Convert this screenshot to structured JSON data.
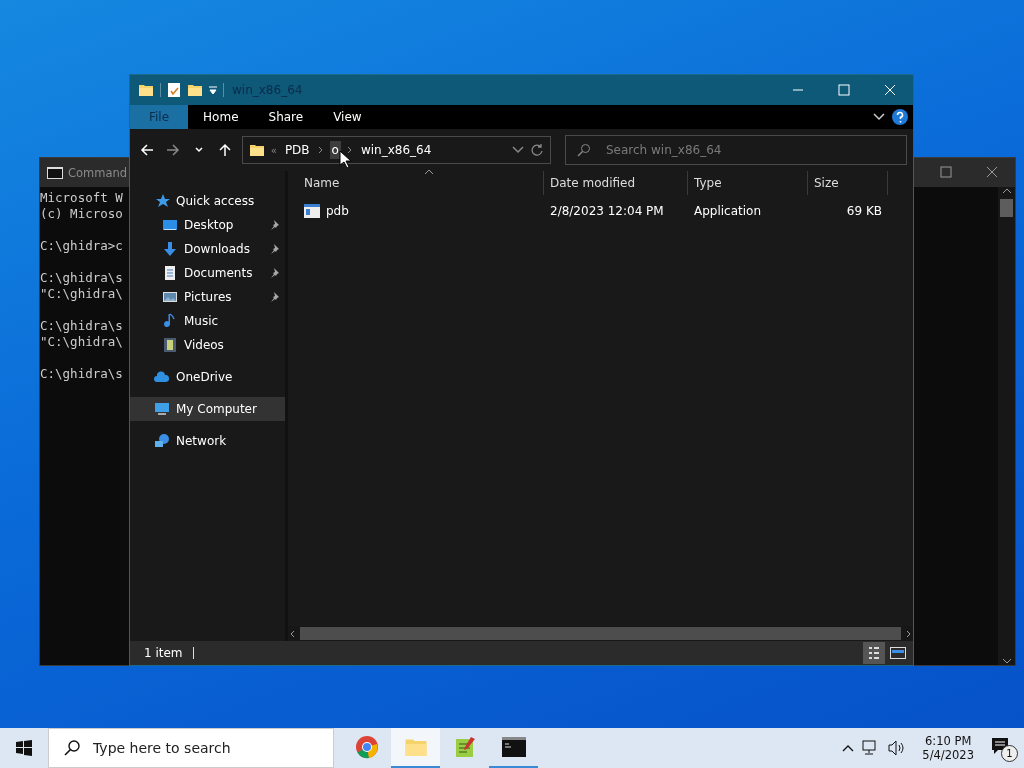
{
  "console_window": {
    "title": "Command",
    "paragraphs": [
      [
        "Microsoft W",
        "(c) Microso"
      ],
      [
        "C:\\ghidra>c"
      ],
      [
        "C:\\ghidra\\s",
        "\"C:\\ghidra\\"
      ],
      [
        "C:\\ghidra\\s",
        "\"C:\\ghidra\\"
      ],
      [
        "C:\\ghidra\\s"
      ]
    ]
  },
  "explorer": {
    "title": "win_x86_64",
    "ribbon_tabs": [
      {
        "label": "File",
        "selected": true
      },
      {
        "label": "Home",
        "selected": false
      },
      {
        "label": "Share",
        "selected": false
      },
      {
        "label": "View",
        "selected": false
      }
    ],
    "address_overflow": "«",
    "address_segments": [
      {
        "label": "PDB",
        "highlighted": false
      },
      {
        "label": "o",
        "highlighted": true
      },
      {
        "label": "win_x86_64",
        "highlighted": false
      }
    ],
    "search": {
      "placeholder": "Search win_x86_64"
    },
    "nav": [
      {
        "label": "Quick access",
        "kind": "star",
        "selected": false,
        "children": [
          {
            "label": "Desktop",
            "kind": "desktop",
            "pinned": true,
            "selected": false
          },
          {
            "label": "Downloads",
            "kind": "download",
            "pinned": true,
            "selected": false
          },
          {
            "label": "Documents",
            "kind": "document",
            "pinned": true,
            "selected": false
          },
          {
            "label": "Pictures",
            "kind": "pictures",
            "pinned": true,
            "selected": false
          },
          {
            "label": "Music",
            "kind": "music",
            "pinned": false,
            "selected": false
          },
          {
            "label": "Videos",
            "kind": "video",
            "pinned": false,
            "selected": false
          }
        ]
      },
      {
        "label": "OneDrive",
        "kind": "cloud",
        "selected": false
      },
      {
        "label": "My Computer",
        "kind": "computer",
        "selected": true
      },
      {
        "label": "Network",
        "kind": "network",
        "selected": false
      }
    ],
    "columns": [
      "Name",
      "Date modified",
      "Type",
      "Size"
    ],
    "rows": [
      {
        "name": "pdb",
        "date_modified": "2/8/2023 12:04 PM",
        "type": "Application",
        "size": "69 KB"
      }
    ],
    "status": "1 item",
    "views": [
      {
        "kind": "details",
        "selected": true
      },
      {
        "kind": "tiles",
        "selected": false
      }
    ]
  },
  "taskbar": {
    "search": {
      "placeholder": "Type here to search"
    },
    "apps": [
      {
        "kind": "browser",
        "running": false,
        "selected": false
      },
      {
        "kind": "folder",
        "running": true,
        "selected": true
      },
      {
        "kind": "notepad",
        "running": false,
        "selected": false
      },
      {
        "kind": "terminal",
        "running": true,
        "selected": false
      }
    ],
    "time": "6:10 PM",
    "date": "5/4/2023",
    "notification_count": "1"
  }
}
